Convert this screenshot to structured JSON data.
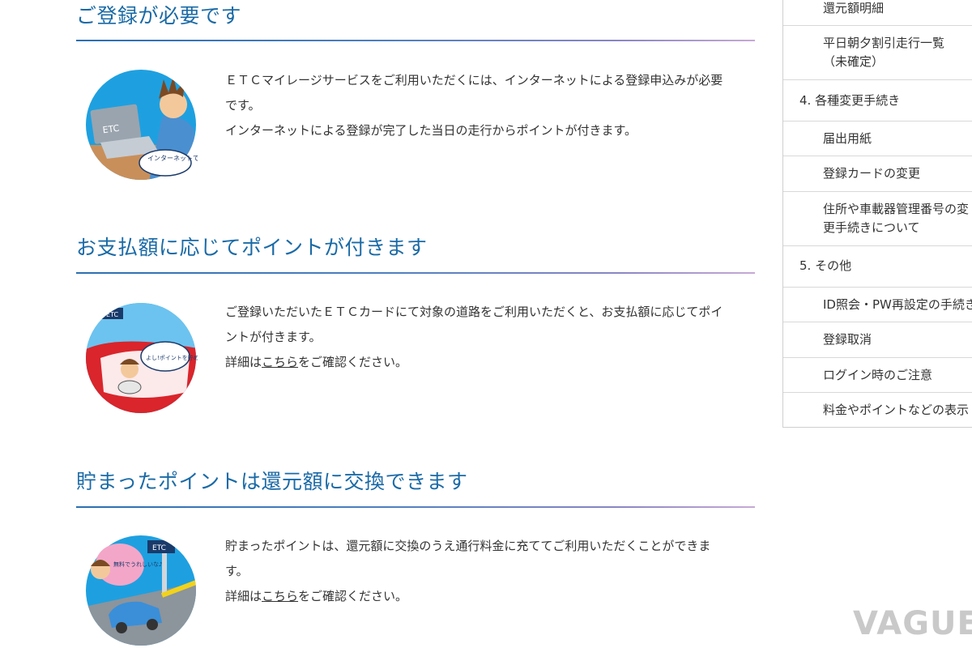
{
  "sections": [
    {
      "title": "ご登録が必要です",
      "illustration_icon": "etc-laptop-registration-illustration",
      "illustration_text": "インターネットで申込み!",
      "lines": [
        "ＥＴＣマイレージサービスをご利用いただくには、インターネットによる登録申込みが必要",
        "です。",
        "インターネットによる登録が完了した当日の走行からポイントが付きます。"
      ]
    },
    {
      "title": "お支払額に応じてポイントが付きます",
      "illustration_icon": "etc-car-driver-illustration",
      "illustration_text": "よし!ポイントを貯めるぞ!",
      "lines": [
        "ご登録いただいたＥＴＣカードにて対象の道路をご利用いただくと、お支払額に応じてポイ",
        "ントが付きます。"
      ],
      "detail_prefix": "詳細は",
      "detail_link": "こちら",
      "detail_suffix": "をご確認ください。"
    },
    {
      "title": "貯まったポイントは還元額に交換できます",
      "illustration_icon": "etc-gate-toll-illustration",
      "illustration_text": "無料でうれしいな♪",
      "lines": [
        "貯まったポイントは、還元額に交換のうえ通行料金に充ててご利用いただくことができま",
        "す。"
      ],
      "detail_prefix": "詳細は",
      "detail_link": "こちら",
      "detail_suffix": "をご確認ください。"
    }
  ],
  "sidebar": {
    "items": [
      {
        "type": "sub",
        "lines": [
          "還元額明細"
        ]
      },
      {
        "type": "sub",
        "lines": [
          "平日朝夕割引走行一覧",
          "（未確定）"
        ]
      },
      {
        "type": "head",
        "lines": [
          "4.  各種変更手続き"
        ]
      },
      {
        "type": "sub",
        "lines": [
          "届出用紙"
        ]
      },
      {
        "type": "sub",
        "lines": [
          "登録カードの変更"
        ]
      },
      {
        "type": "sub",
        "lines": [
          "住所や車載器管理番号の変",
          "更手続きについて"
        ]
      },
      {
        "type": "head",
        "lines": [
          "5.  その他"
        ]
      },
      {
        "type": "sub",
        "lines": [
          "ID照会・PW再設定の手続き"
        ]
      },
      {
        "type": "sub",
        "lines": [
          "登録取消"
        ]
      },
      {
        "type": "sub",
        "lines": [
          "ログイン時のご注意"
        ]
      },
      {
        "type": "sub",
        "lines": [
          "料金やポイントなどの表示"
        ]
      }
    ]
  },
  "watermark": "VAGUE",
  "colors": {
    "heading": "#1a6aa6",
    "rule_start": "#2b6fb0",
    "rule_end": "#c7a9d6",
    "illustration_blue": "#1ea0e0",
    "car_red": "#d9252b"
  }
}
